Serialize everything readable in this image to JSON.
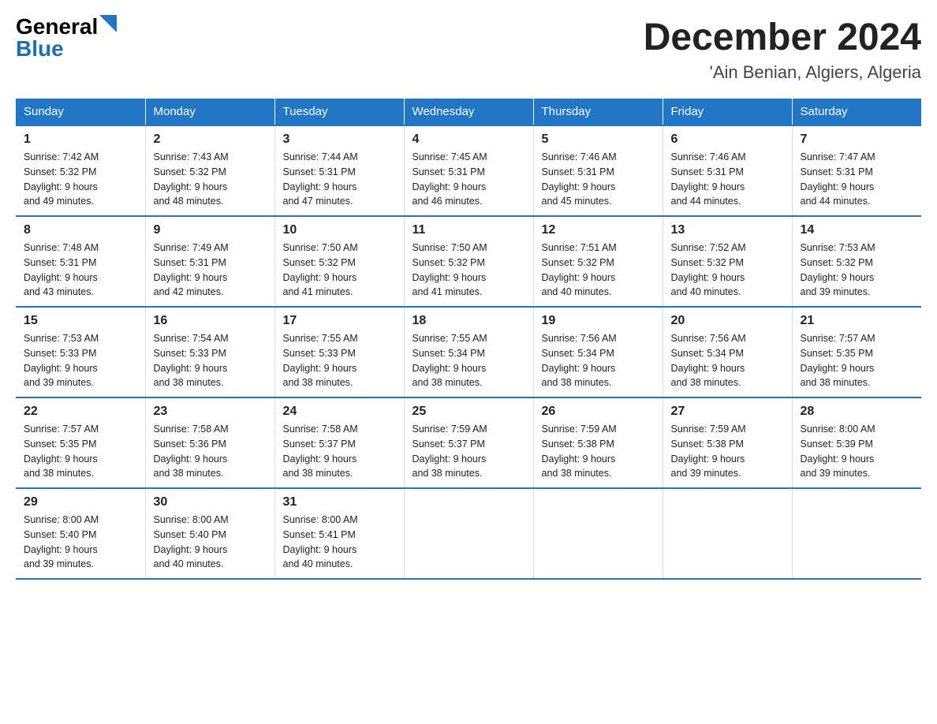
{
  "logo": {
    "general": "General",
    "blue": "Blue"
  },
  "title": {
    "month": "December 2024",
    "location": "'Ain Benian, Algiers, Algeria"
  },
  "headers": [
    "Sunday",
    "Monday",
    "Tuesday",
    "Wednesday",
    "Thursday",
    "Friday",
    "Saturday"
  ],
  "weeks": [
    [
      {
        "day": "1",
        "sunrise": "7:42 AM",
        "sunset": "5:32 PM",
        "daylight": "9 hours and 49 minutes."
      },
      {
        "day": "2",
        "sunrise": "7:43 AM",
        "sunset": "5:32 PM",
        "daylight": "9 hours and 48 minutes."
      },
      {
        "day": "3",
        "sunrise": "7:44 AM",
        "sunset": "5:31 PM",
        "daylight": "9 hours and 47 minutes."
      },
      {
        "day": "4",
        "sunrise": "7:45 AM",
        "sunset": "5:31 PM",
        "daylight": "9 hours and 46 minutes."
      },
      {
        "day": "5",
        "sunrise": "7:46 AM",
        "sunset": "5:31 PM",
        "daylight": "9 hours and 45 minutes."
      },
      {
        "day": "6",
        "sunrise": "7:46 AM",
        "sunset": "5:31 PM",
        "daylight": "9 hours and 44 minutes."
      },
      {
        "day": "7",
        "sunrise": "7:47 AM",
        "sunset": "5:31 PM",
        "daylight": "9 hours and 44 minutes."
      }
    ],
    [
      {
        "day": "8",
        "sunrise": "7:48 AM",
        "sunset": "5:31 PM",
        "daylight": "9 hours and 43 minutes."
      },
      {
        "day": "9",
        "sunrise": "7:49 AM",
        "sunset": "5:31 PM",
        "daylight": "9 hours and 42 minutes."
      },
      {
        "day": "10",
        "sunrise": "7:50 AM",
        "sunset": "5:32 PM",
        "daylight": "9 hours and 41 minutes."
      },
      {
        "day": "11",
        "sunrise": "7:50 AM",
        "sunset": "5:32 PM",
        "daylight": "9 hours and 41 minutes."
      },
      {
        "day": "12",
        "sunrise": "7:51 AM",
        "sunset": "5:32 PM",
        "daylight": "9 hours and 40 minutes."
      },
      {
        "day": "13",
        "sunrise": "7:52 AM",
        "sunset": "5:32 PM",
        "daylight": "9 hours and 40 minutes."
      },
      {
        "day": "14",
        "sunrise": "7:53 AM",
        "sunset": "5:32 PM",
        "daylight": "9 hours and 39 minutes."
      }
    ],
    [
      {
        "day": "15",
        "sunrise": "7:53 AM",
        "sunset": "5:33 PM",
        "daylight": "9 hours and 39 minutes."
      },
      {
        "day": "16",
        "sunrise": "7:54 AM",
        "sunset": "5:33 PM",
        "daylight": "9 hours and 38 minutes."
      },
      {
        "day": "17",
        "sunrise": "7:55 AM",
        "sunset": "5:33 PM",
        "daylight": "9 hours and 38 minutes."
      },
      {
        "day": "18",
        "sunrise": "7:55 AM",
        "sunset": "5:34 PM",
        "daylight": "9 hours and 38 minutes."
      },
      {
        "day": "19",
        "sunrise": "7:56 AM",
        "sunset": "5:34 PM",
        "daylight": "9 hours and 38 minutes."
      },
      {
        "day": "20",
        "sunrise": "7:56 AM",
        "sunset": "5:34 PM",
        "daylight": "9 hours and 38 minutes."
      },
      {
        "day": "21",
        "sunrise": "7:57 AM",
        "sunset": "5:35 PM",
        "daylight": "9 hours and 38 minutes."
      }
    ],
    [
      {
        "day": "22",
        "sunrise": "7:57 AM",
        "sunset": "5:35 PM",
        "daylight": "9 hours and 38 minutes."
      },
      {
        "day": "23",
        "sunrise": "7:58 AM",
        "sunset": "5:36 PM",
        "daylight": "9 hours and 38 minutes."
      },
      {
        "day": "24",
        "sunrise": "7:58 AM",
        "sunset": "5:37 PM",
        "daylight": "9 hours and 38 minutes."
      },
      {
        "day": "25",
        "sunrise": "7:59 AM",
        "sunset": "5:37 PM",
        "daylight": "9 hours and 38 minutes."
      },
      {
        "day": "26",
        "sunrise": "7:59 AM",
        "sunset": "5:38 PM",
        "daylight": "9 hours and 38 minutes."
      },
      {
        "day": "27",
        "sunrise": "7:59 AM",
        "sunset": "5:38 PM",
        "daylight": "9 hours and 39 minutes."
      },
      {
        "day": "28",
        "sunrise": "8:00 AM",
        "sunset": "5:39 PM",
        "daylight": "9 hours and 39 minutes."
      }
    ],
    [
      {
        "day": "29",
        "sunrise": "8:00 AM",
        "sunset": "5:40 PM",
        "daylight": "9 hours and 39 minutes."
      },
      {
        "day": "30",
        "sunrise": "8:00 AM",
        "sunset": "5:40 PM",
        "daylight": "9 hours and 40 minutes."
      },
      {
        "day": "31",
        "sunrise": "8:00 AM",
        "sunset": "5:41 PM",
        "daylight": "9 hours and 40 minutes."
      },
      null,
      null,
      null,
      null
    ]
  ]
}
